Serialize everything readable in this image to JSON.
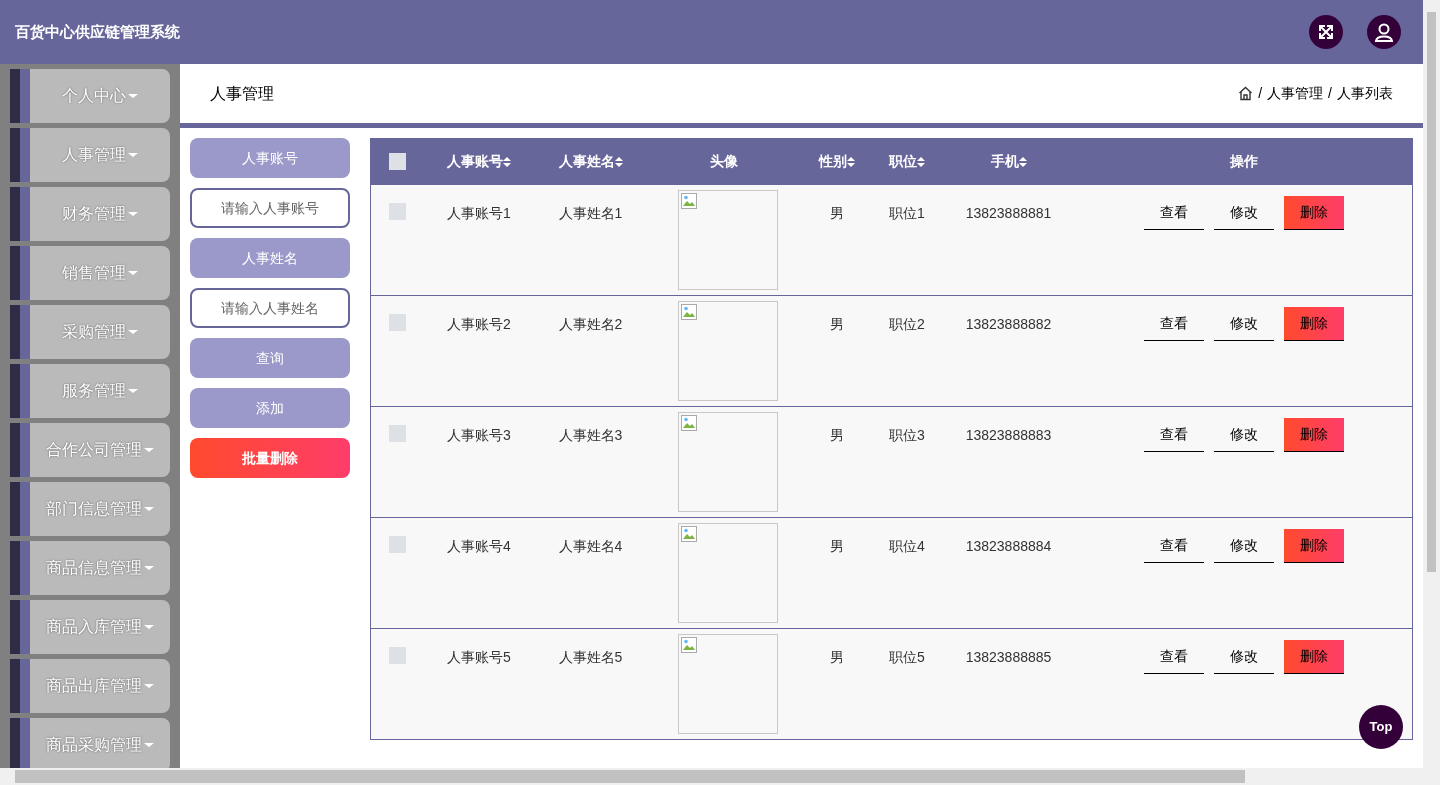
{
  "header": {
    "title": "百货中心供应链管理系统"
  },
  "sidebar": {
    "items": [
      {
        "label": "个人中心"
      },
      {
        "label": "人事管理"
      },
      {
        "label": "财务管理"
      },
      {
        "label": "销售管理"
      },
      {
        "label": "采购管理"
      },
      {
        "label": "服务管理"
      },
      {
        "label": "合作公司管理"
      },
      {
        "label": "部门信息管理"
      },
      {
        "label": "商品信息管理"
      },
      {
        "label": "商品入库管理"
      },
      {
        "label": "商品出库管理"
      },
      {
        "label": "商品采购管理"
      }
    ]
  },
  "page_title": "人事管理",
  "breadcrumb": [
    "/",
    "人事管理",
    "/",
    "人事列表"
  ],
  "search_panel": [
    {
      "kind": "label",
      "text": "人事账号"
    },
    {
      "kind": "input",
      "placeholder": "请输入人事账号"
    },
    {
      "kind": "label",
      "text": "人事姓名"
    },
    {
      "kind": "input",
      "placeholder": "请输入人事姓名"
    },
    {
      "kind": "button",
      "text": "查询"
    },
    {
      "kind": "button",
      "text": "添加"
    },
    {
      "kind": "danger",
      "text": "批量删除"
    }
  ],
  "table": {
    "select_all": {
      "checked": false
    },
    "columns": [
      {
        "label": "人事账号",
        "sortable": true
      },
      {
        "label": "人事姓名",
        "sortable": true
      },
      {
        "label": "头像",
        "sortable": false
      },
      {
        "label": "性别",
        "sortable": true
      },
      {
        "label": "职位",
        "sortable": true
      },
      {
        "label": "手机",
        "sortable": true
      },
      {
        "label": "操作",
        "sortable": false
      }
    ],
    "rows": [
      {
        "checked": false,
        "cells": [
          "人事账号1",
          "人事姓名1",
          "",
          "男",
          "职位1",
          "13823888881"
        ],
        "actions": [
          {
            "kind": "plain",
            "text": "查看"
          },
          {
            "kind": "plain",
            "text": "修改"
          },
          {
            "kind": "danger",
            "text": "删除"
          }
        ]
      },
      {
        "checked": false,
        "cells": [
          "人事账号2",
          "人事姓名2",
          "",
          "男",
          "职位2",
          "13823888882"
        ],
        "actions": [
          {
            "kind": "plain",
            "text": "查看"
          },
          {
            "kind": "plain",
            "text": "修改"
          },
          {
            "kind": "danger",
            "text": "删除"
          }
        ]
      },
      {
        "checked": false,
        "cells": [
          "人事账号3",
          "人事姓名3",
          "",
          "男",
          "职位3",
          "13823888883"
        ],
        "actions": [
          {
            "kind": "plain",
            "text": "查看"
          },
          {
            "kind": "plain",
            "text": "修改"
          },
          {
            "kind": "danger",
            "text": "删除"
          }
        ]
      },
      {
        "checked": false,
        "cells": [
          "人事账号4",
          "人事姓名4",
          "",
          "男",
          "职位4",
          "13823888884"
        ],
        "actions": [
          {
            "kind": "plain",
            "text": "查看"
          },
          {
            "kind": "plain",
            "text": "修改"
          },
          {
            "kind": "danger",
            "text": "删除"
          }
        ]
      },
      {
        "checked": false,
        "cells": [
          "人事账号5",
          "人事姓名5",
          "",
          "男",
          "职位5",
          "13823888885"
        ],
        "actions": [
          {
            "kind": "plain",
            "text": "查看"
          },
          {
            "kind": "plain",
            "text": "修改"
          },
          {
            "kind": "danger",
            "text": "删除"
          }
        ]
      }
    ]
  },
  "back_to_top": "Top"
}
